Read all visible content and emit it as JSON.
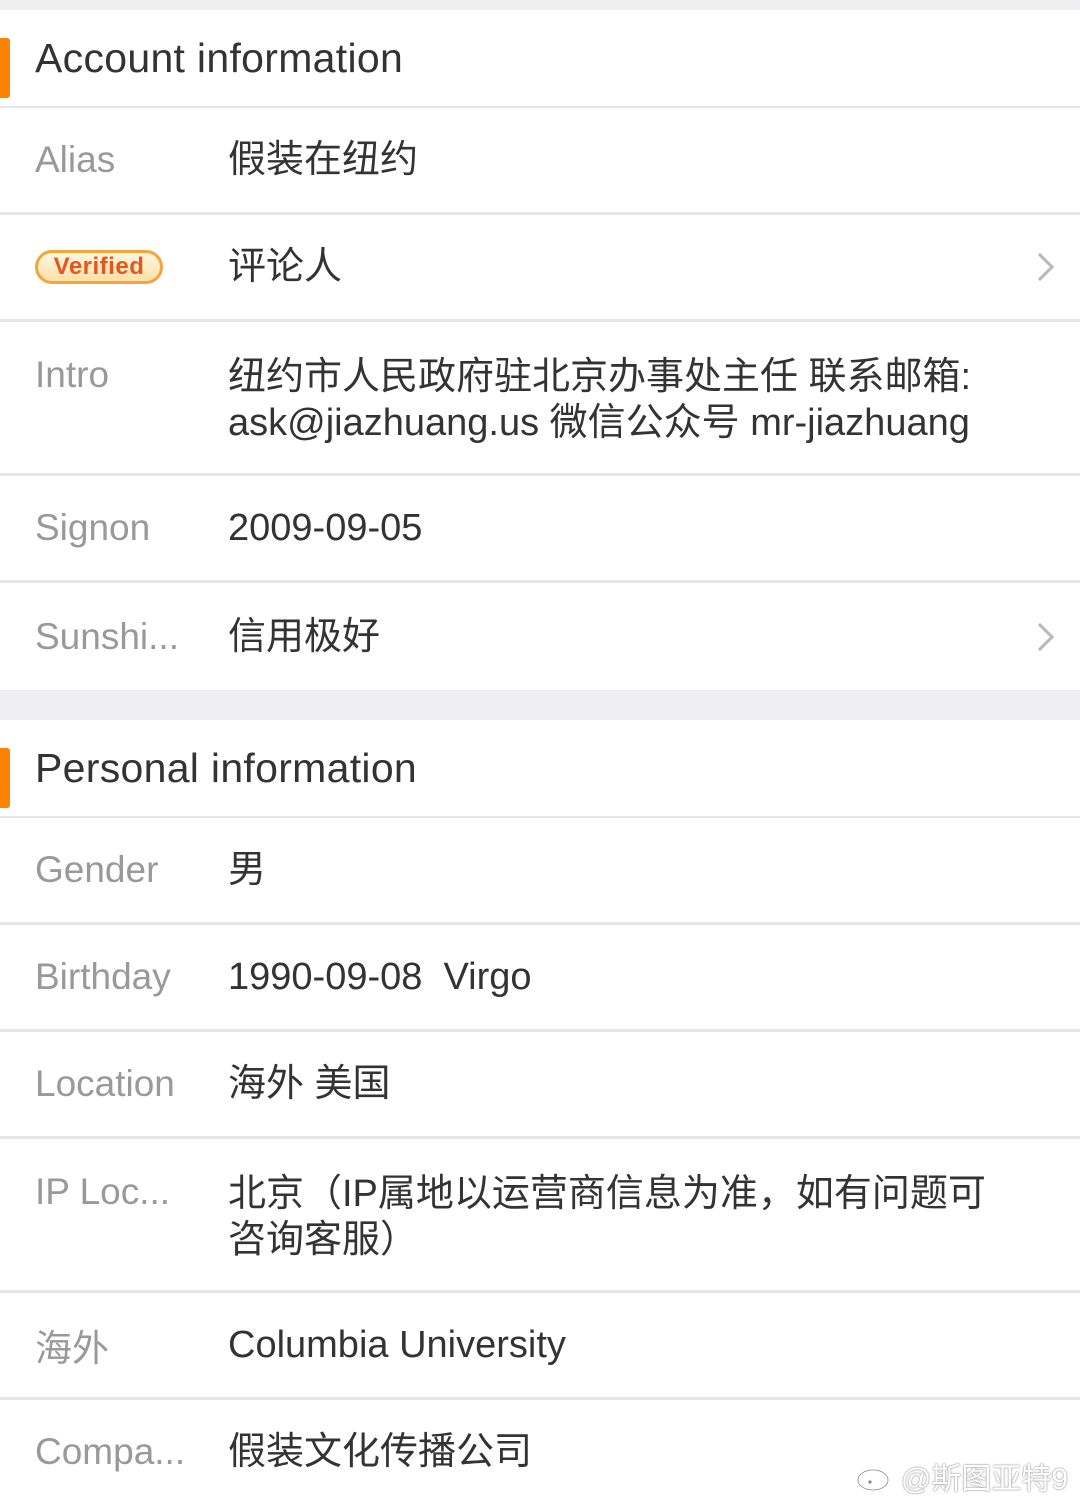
{
  "account_section": {
    "title": "Account information",
    "rows": {
      "alias": {
        "label": "Alias",
        "value": "假装在纽约"
      },
      "verified": {
        "badge": "Verified",
        "value": "评论人"
      },
      "intro": {
        "label": "Intro",
        "value_line1": "纽约市人民政府驻北京办事处主任 联系邮箱:",
        "value_line2": "ask@jiazhuang.us 微信公众号 mr-jiazhuang"
      },
      "signon": {
        "label": "Signon",
        "value": "2009-09-05"
      },
      "sunshine": {
        "label": "Sunshi...",
        "value": "信用极好"
      }
    }
  },
  "personal_section": {
    "title": "Personal information",
    "rows": {
      "gender": {
        "label": "Gender",
        "value": "男"
      },
      "birthday": {
        "label": "Birthday",
        "value": "1990-09-08  Virgo"
      },
      "location": {
        "label": "Location",
        "value": "海外 美国"
      },
      "ip_location": {
        "label": "IP Loc...",
        "value_line1": "北京（IP属地以运营商信息为准，如有问题可",
        "value_line2": "咨询客服）"
      },
      "overseas": {
        "label": "海外",
        "value": "Columbia University"
      },
      "company": {
        "label": "Compa...",
        "value": "假装文化传播公司"
      }
    }
  },
  "watermark": {
    "text": "@斯图亚特9",
    "icon": "weibo-icon"
  },
  "colors": {
    "accent": "#ff8200",
    "badge_text": "#e8541e",
    "label": "#999999",
    "value": "#333333"
  }
}
